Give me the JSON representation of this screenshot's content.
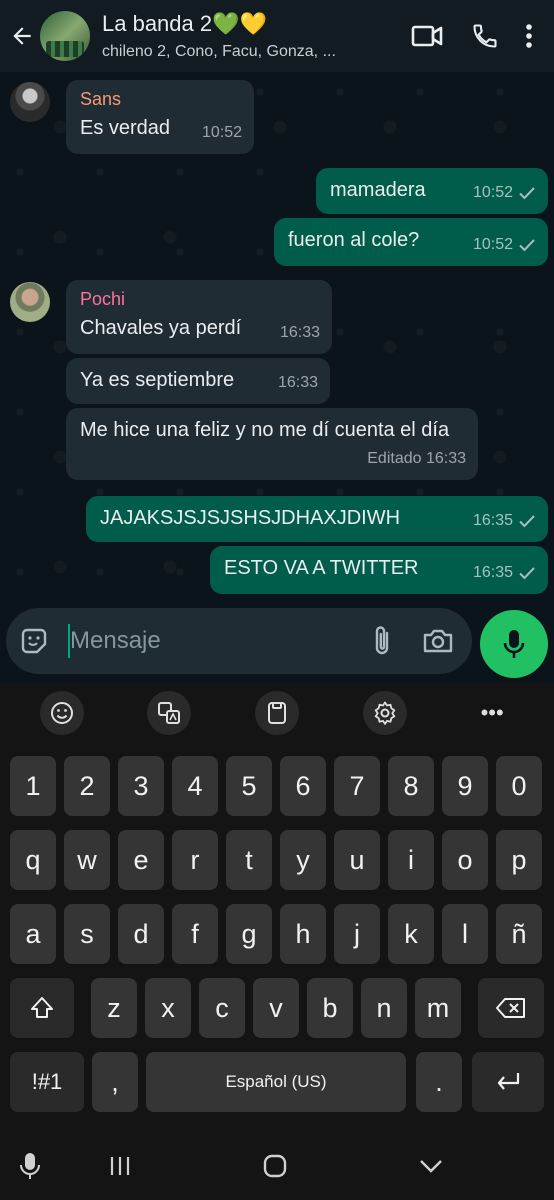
{
  "header": {
    "title": "La banda 2💚💛",
    "subtitle": "chileno 2, Cono, Facu, Gonza, ...",
    "icons": [
      "back-arrow-icon",
      "video-call-icon",
      "phone-icon",
      "more-vert-icon"
    ]
  },
  "messages": [
    {
      "direction": "in",
      "sender": "Sans",
      "sender_color": "#f79877",
      "text": "Es verdad",
      "time": "10:52"
    },
    {
      "direction": "out",
      "text": "mamadera",
      "time": "10:52"
    },
    {
      "direction": "out",
      "text": "fueron al cole?",
      "time": "10:52"
    },
    {
      "direction": "in",
      "sender": "Pochi",
      "sender_color": "#ff72a1",
      "text": "Chavales ya perdí",
      "time": "16:33"
    },
    {
      "direction": "in",
      "text": "Ya es septiembre",
      "time": "16:33"
    },
    {
      "direction": "in",
      "text": "Me hice una feliz y no me dí cuenta el día",
      "time": "Editado 16:33"
    },
    {
      "direction": "out",
      "text": "JAJAKSJSJSJSHSJDHAXJDIWH",
      "time": "16:35"
    },
    {
      "direction": "out",
      "text": "ESTO VA A TWITTER",
      "time": "16:35"
    }
  ],
  "composer": {
    "placeholder": "Mensaje",
    "icons": [
      "sticker-icon",
      "attach-icon",
      "camera-icon",
      "mic-icon"
    ]
  },
  "keyboard": {
    "toolbar": [
      "emoji-icon",
      "translate-icon",
      "clipboard-icon",
      "settings-icon",
      "more-icon"
    ],
    "toolbar_more": "•••",
    "row_numbers": [
      "1",
      "2",
      "3",
      "4",
      "5",
      "6",
      "7",
      "8",
      "9",
      "0"
    ],
    "row_q": [
      "q",
      "w",
      "e",
      "r",
      "t",
      "y",
      "u",
      "i",
      "o",
      "p"
    ],
    "row_a": [
      "a",
      "s",
      "d",
      "f",
      "g",
      "h",
      "j",
      "k",
      "l",
      "ñ"
    ],
    "row_z": [
      "z",
      "x",
      "c",
      "v",
      "b",
      "n",
      "m"
    ],
    "symbols_key": "!#1",
    "comma_key": ",",
    "space_label": "Español (US)",
    "period_key": "."
  },
  "colors": {
    "incoming_bubble": "#202c33",
    "outgoing_bubble": "#005c4b",
    "accent": "#21c063"
  }
}
